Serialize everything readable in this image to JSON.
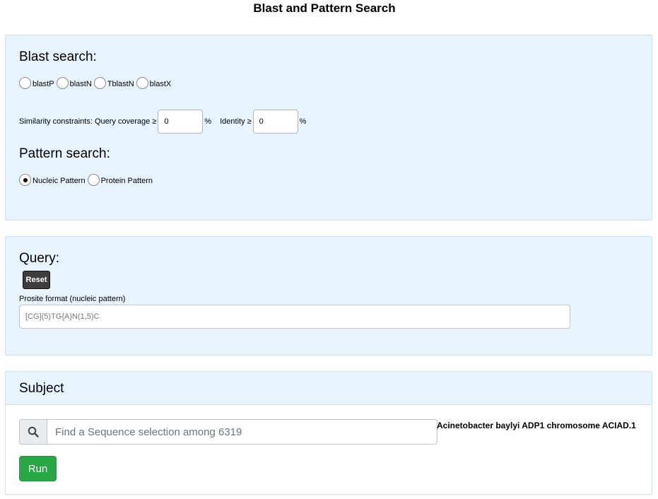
{
  "page": {
    "title": "Blast and Pattern Search"
  },
  "blast": {
    "heading": "Blast search:",
    "options": [
      {
        "label": "blastP",
        "checked": false
      },
      {
        "label": "blastN",
        "checked": false
      },
      {
        "label": "TblastN",
        "checked": false
      },
      {
        "label": "blastX",
        "checked": false
      }
    ],
    "constraints": {
      "label": "Similarity constraints: Query coverage ≥",
      "coverage_value": "0",
      "coverage_unit": "%",
      "identity_label": "Identity ≥",
      "identity_value": "0",
      "identity_unit": "%"
    }
  },
  "pattern": {
    "heading": "Pattern search:",
    "options": [
      {
        "label": "Nucleic Pattern",
        "checked": true
      },
      {
        "label": "Protein Pattern",
        "checked": false
      }
    ]
  },
  "query": {
    "heading": "Query:",
    "reset_label": "Reset",
    "field_label": "Prosite format (nucleic pattern)",
    "placeholder": "[CG](5)TG{A}N(1,5)C"
  },
  "subject": {
    "heading": "Subject",
    "search_icon": "search-icon",
    "search_placeholder": "Find a Sequence selection among 6319",
    "selection_label": "Acinetobacter baylyi ADP1 chromosome ACIAD.1",
    "run_label": "Run"
  },
  "colors": {
    "panel_bg": "#e8f4fd",
    "run_button": "#28a745",
    "reset_button": "#3d3d3d"
  }
}
